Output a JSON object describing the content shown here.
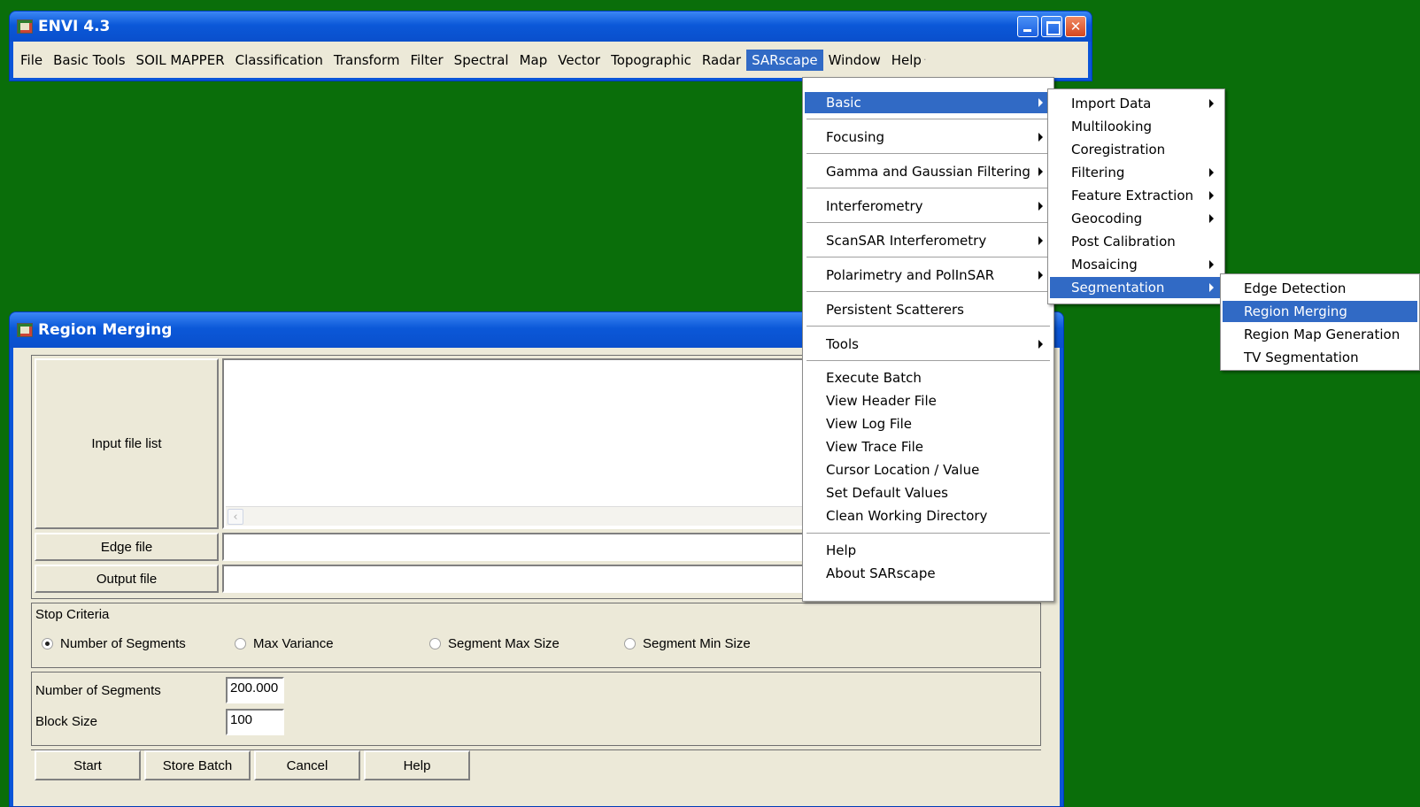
{
  "main_window": {
    "title": "ENVI 4.3",
    "menus": [
      "File",
      "Basic Tools",
      "SOIL MAPPER",
      "Classification",
      "Transform",
      "Filter",
      "Spectral",
      "Map",
      "Vector",
      "Topographic",
      "Radar",
      "SARscape",
      "Window",
      "Help"
    ],
    "active_menu": "SARscape"
  },
  "sarscape_menu": {
    "items": [
      {
        "label": "Basic",
        "submenu": true,
        "highlighted": true
      },
      {
        "label": "Focusing",
        "submenu": true
      },
      {
        "label": "Gamma and Gaussian Filtering",
        "submenu": true
      },
      {
        "label": "Interferometry",
        "submenu": true
      },
      {
        "label": "ScanSAR Interferometry",
        "submenu": true
      },
      {
        "label": "Polarimetry and PolInSAR",
        "submenu": true
      },
      {
        "label": "Persistent Scatterers",
        "submenu": false
      },
      {
        "label": "Tools",
        "submenu": true
      },
      {
        "label": "Execute Batch",
        "submenu": false
      },
      {
        "label": "View Header File",
        "submenu": false
      },
      {
        "label": "View Log File",
        "submenu": false
      },
      {
        "label": "View Trace File",
        "submenu": false
      },
      {
        "label": "Cursor Location / Value",
        "submenu": false
      },
      {
        "label": "Set Default Values",
        "submenu": false
      },
      {
        "label": "Clean Working Directory",
        "submenu": false
      },
      {
        "label": "Help",
        "submenu": false
      },
      {
        "label": "About SARscape",
        "submenu": false
      }
    ]
  },
  "basic_menu": {
    "items": [
      {
        "label": "Import Data",
        "submenu": true
      },
      {
        "label": "Multilooking",
        "submenu": false
      },
      {
        "label": "Coregistration",
        "submenu": false
      },
      {
        "label": "Filtering",
        "submenu": true
      },
      {
        "label": "Feature Extraction",
        "submenu": true
      },
      {
        "label": "Geocoding",
        "submenu": true
      },
      {
        "label": "Post Calibration",
        "submenu": false
      },
      {
        "label": "Mosaicing",
        "submenu": true
      },
      {
        "label": "Segmentation",
        "submenu": true,
        "highlighted": true
      }
    ]
  },
  "segmentation_menu": {
    "items": [
      {
        "label": "Edge Detection"
      },
      {
        "label": "Region Merging",
        "highlighted": true
      },
      {
        "label": "Region Map Generation"
      },
      {
        "label": "TV Segmentation"
      }
    ]
  },
  "dialog": {
    "title": "Region Merging",
    "input_file_list_label": "Input file list",
    "edge_file_label": "Edge file",
    "output_file_label": "Output file",
    "stop_criteria_label": "Stop Criteria",
    "radios": [
      {
        "label": "Number of Segments",
        "checked": true
      },
      {
        "label": "Max Variance",
        "checked": false
      },
      {
        "label": "Segment Max Size",
        "checked": false
      },
      {
        "label": "Segment Min Size",
        "checked": false
      }
    ],
    "number_of_segments_label": "Number of Segments",
    "number_of_segments_value": "200.000",
    "block_size_label": "Block Size",
    "block_size_value": "100",
    "buttons": {
      "start": "Start",
      "store_batch": "Store Batch",
      "cancel": "Cancel",
      "help": "Help"
    }
  },
  "colors": {
    "desktop": "#0a6e0a",
    "xp_blue": "#0a55d8",
    "highlight": "#316ac5",
    "dialog_bg": "#ece9d8"
  }
}
